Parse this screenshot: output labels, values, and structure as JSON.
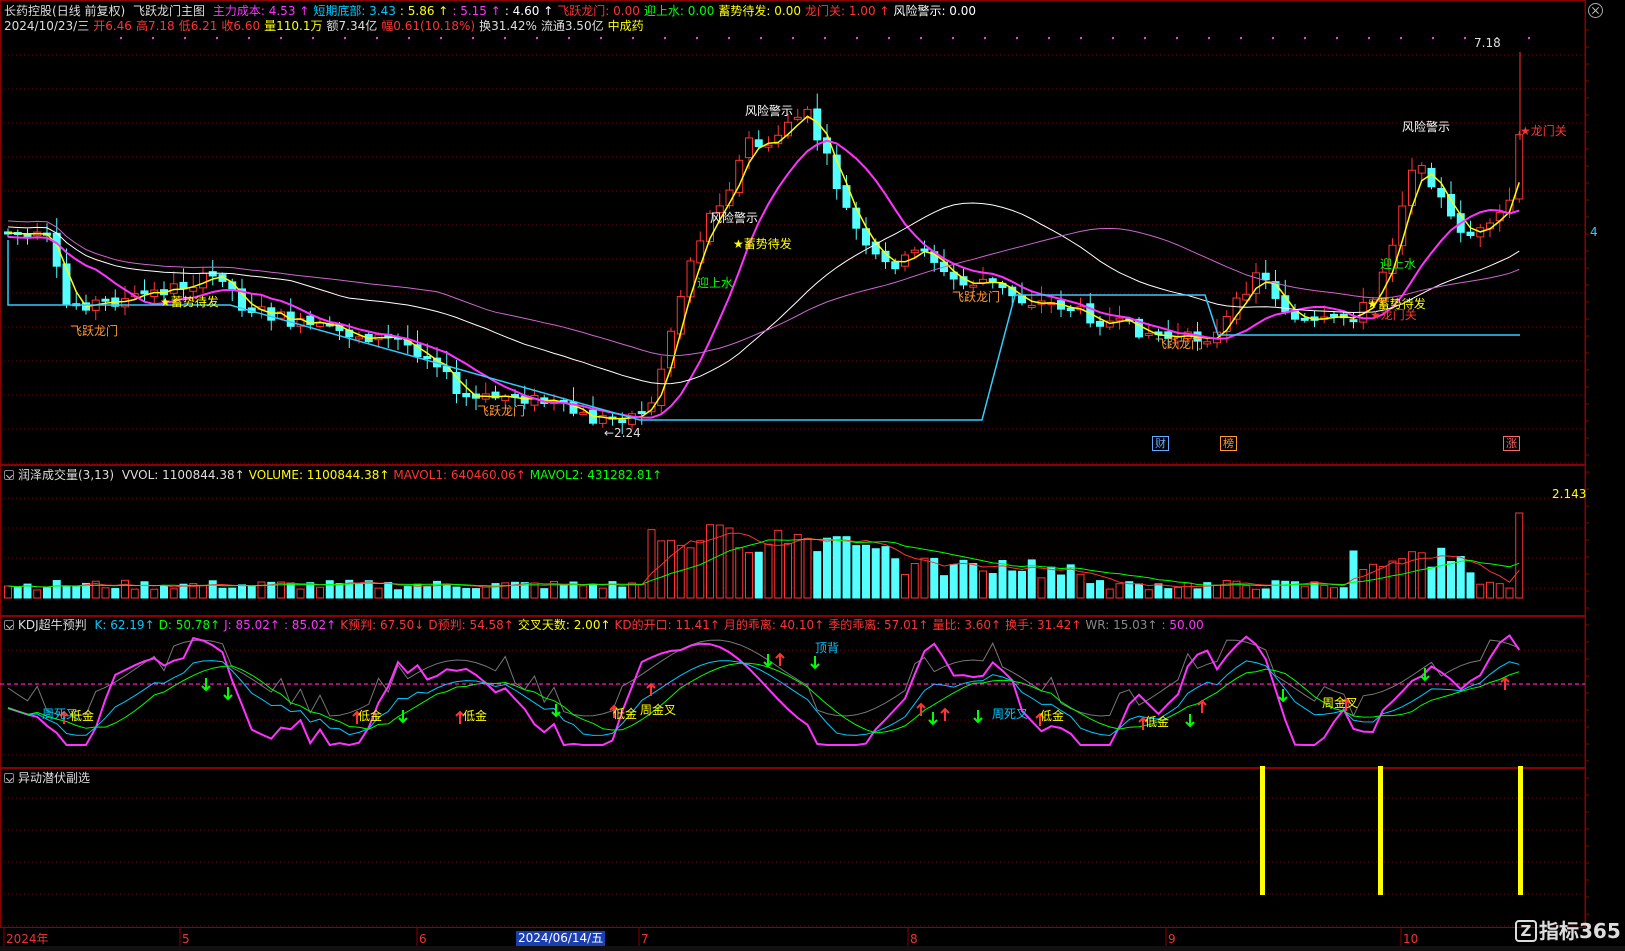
{
  "main": {
    "stock_name": "长药控股",
    "period": "(日线 前复权)",
    "formula": "飞跃龙门主图",
    "line1": [
      {
        "label": "主力成本:",
        "value": "4.53",
        "arrow": "↑",
        "color": "#ff33ff"
      },
      {
        "label": "短期底部:",
        "value": "3.43",
        "arrow": "",
        "color": "#00c8ff"
      },
      {
        "label": ":",
        "value": "5.86",
        "arrow": "↑",
        "color": "#ffff00"
      },
      {
        "label": ":",
        "value": "5.15",
        "arrow": "↑",
        "color": "#ff33ff"
      },
      {
        "label": ":",
        "value": "4.60",
        "arrow": "↑",
        "color": "#ffffff"
      },
      {
        "label": "飞跃龙门:",
        "value": "0.00",
        "arrow": "",
        "color": "#ff3333"
      },
      {
        "label": "迎上水:",
        "value": "0.00",
        "arrow": "",
        "color": "#00ff00"
      },
      {
        "label": "蓄势待发:",
        "value": "0.00",
        "arrow": "",
        "color": "#ffff00"
      },
      {
        "label": "龙门关:",
        "value": "1.00",
        "arrow": "↑",
        "color": "#ff3333"
      },
      {
        "label": "风险警示:",
        "value": "0.00",
        "arrow": "",
        "color": "#ffffff"
      }
    ],
    "line2": [
      {
        "text": "2024/10/23/三",
        "color": "#dddddd"
      },
      {
        "text": "开6.46",
        "color": "#ff3333"
      },
      {
        "text": "高7.18",
        "color": "#ff3333"
      },
      {
        "text": "低6.21",
        "color": "#ff3333"
      },
      {
        "text": "收6.60",
        "color": "#ff3333"
      },
      {
        "text": "量110.1万",
        "color": "#ffff00"
      },
      {
        "text": "额7.34亿",
        "color": "#dddddd"
      },
      {
        "text": "幅0.61(10.18%)",
        "color": "#ff3333"
      },
      {
        "text": "换31.42%",
        "color": "#dddddd"
      },
      {
        "text": "流通3.50亿",
        "color": "#dddddd"
      },
      {
        "text": "中成药",
        "color": "#ffff00"
      }
    ],
    "annotations": [
      {
        "text": "7.18",
        "color": "#dddddd"
      },
      {
        "text": "←2.24",
        "color": "#dddddd"
      },
      {
        "text": "风险警示",
        "color": "#ffffff"
      },
      {
        "text": "风险警示",
        "color": "#ffffff"
      },
      {
        "text": "风险警示",
        "color": "#ffffff"
      },
      {
        "text": "★蓄势待发",
        "color": "#ffff00"
      },
      {
        "text": "★蓄势待发",
        "color": "#ffff00"
      },
      {
        "text": "★蓄势待发",
        "color": "#ffff00"
      },
      {
        "text": "飞跃龙门",
        "color": "#ff9933"
      },
      {
        "text": "飞跃龙门",
        "color": "#ff9933"
      },
      {
        "text": "飞跃龙门",
        "color": "#ff9933"
      },
      {
        "text": "飞跃龙门",
        "color": "#ff9933"
      },
      {
        "text": "迎上水",
        "color": "#00ff00"
      },
      {
        "text": "迎上水",
        "color": "#00ff00"
      },
      {
        "text": "★龙门关",
        "color": "#ff3333"
      },
      {
        "text": "★龙门关",
        "color": "#ff3333"
      }
    ],
    "event_tags": [
      {
        "text": "财",
        "color": "#66aaff"
      },
      {
        "text": "榜",
        "color": "#ff9933"
      },
      {
        "text": "涨",
        "color": "#ff6666"
      }
    ],
    "right_value": "4"
  },
  "volume": {
    "title": "润泽成交量(3,13)",
    "items": [
      {
        "text": "VVOL: 1100844.38↑",
        "color": "#dddddd"
      },
      {
        "text": "VOLUME: 1100844.38↑",
        "color": "#ffff00"
      },
      {
        "text": "MAVOL1: 640460.06↑",
        "color": "#ff3333"
      },
      {
        "text": "MAVOL2: 431282.81↑",
        "color": "#00ff00"
      }
    ],
    "max_label": "2.143"
  },
  "kdj": {
    "title": "KDJ超牛预判",
    "items": [
      {
        "text": "K: 62.19↑",
        "color": "#00c8ff"
      },
      {
        "text": "D: 50.78↑",
        "color": "#00ff00"
      },
      {
        "text": "J: 85.02↑",
        "color": "#ff33ff"
      },
      {
        "text": ": 85.02↑",
        "color": "#ff33ff"
      },
      {
        "text": "K预判: 67.50↓",
        "color": "#ff3333"
      },
      {
        "text": "D预判: 54.58↑",
        "color": "#ff3333"
      },
      {
        "text": "交叉天数: 2.00↑",
        "color": "#ffff00"
      },
      {
        "text": "KD的开口: 11.41↑",
        "color": "#ff3333"
      },
      {
        "text": "月的乖离: 40.10↑",
        "color": "#ff3333"
      },
      {
        "text": "季的乖离: 57.01↑",
        "color": "#ff3333"
      },
      {
        "text": "量比: 3.60↑",
        "color": "#ff3333"
      },
      {
        "text": "换手: 31.42↑",
        "color": "#ff3333"
      },
      {
        "text": "WR: 15.03↑",
        "color": "#888888"
      },
      {
        "text": ": 50.00",
        "color": "#ff33ff"
      }
    ],
    "annotations": [
      {
        "text": "周死叉",
        "color": "#00c8ff"
      },
      {
        "text": "低金",
        "color": "#ffff00"
      },
      {
        "text": "低金",
        "color": "#ffff00"
      },
      {
        "text": "低金",
        "color": "#ffff00"
      },
      {
        "text": "低金",
        "color": "#ffff00"
      },
      {
        "text": "周金叉",
        "color": "#ffff00"
      },
      {
        "text": "顶背",
        "color": "#00c8ff"
      },
      {
        "text": "周死叉",
        "color": "#00c8ff"
      },
      {
        "text": "低金",
        "color": "#ffff00"
      },
      {
        "text": "低金",
        "color": "#ffff00"
      },
      {
        "text": "周金叉",
        "color": "#ffff00"
      }
    ]
  },
  "signal": {
    "title": "异动潜伏副选"
  },
  "xaxis": {
    "ticks": [
      "2024年",
      "5",
      "6",
      "7",
      "8",
      "9",
      "10"
    ],
    "cursor_date": "2024/06/14/五"
  },
  "logo": {
    "mark": "Z",
    "text": "指标365"
  },
  "colors": {
    "up": "#ff3333",
    "down": "#54ffff",
    "ma_short": "#ffff00",
    "ma_mid": "#ff33ff",
    "ma_long": "#ffffff",
    "support": "#33ccff"
  }
}
